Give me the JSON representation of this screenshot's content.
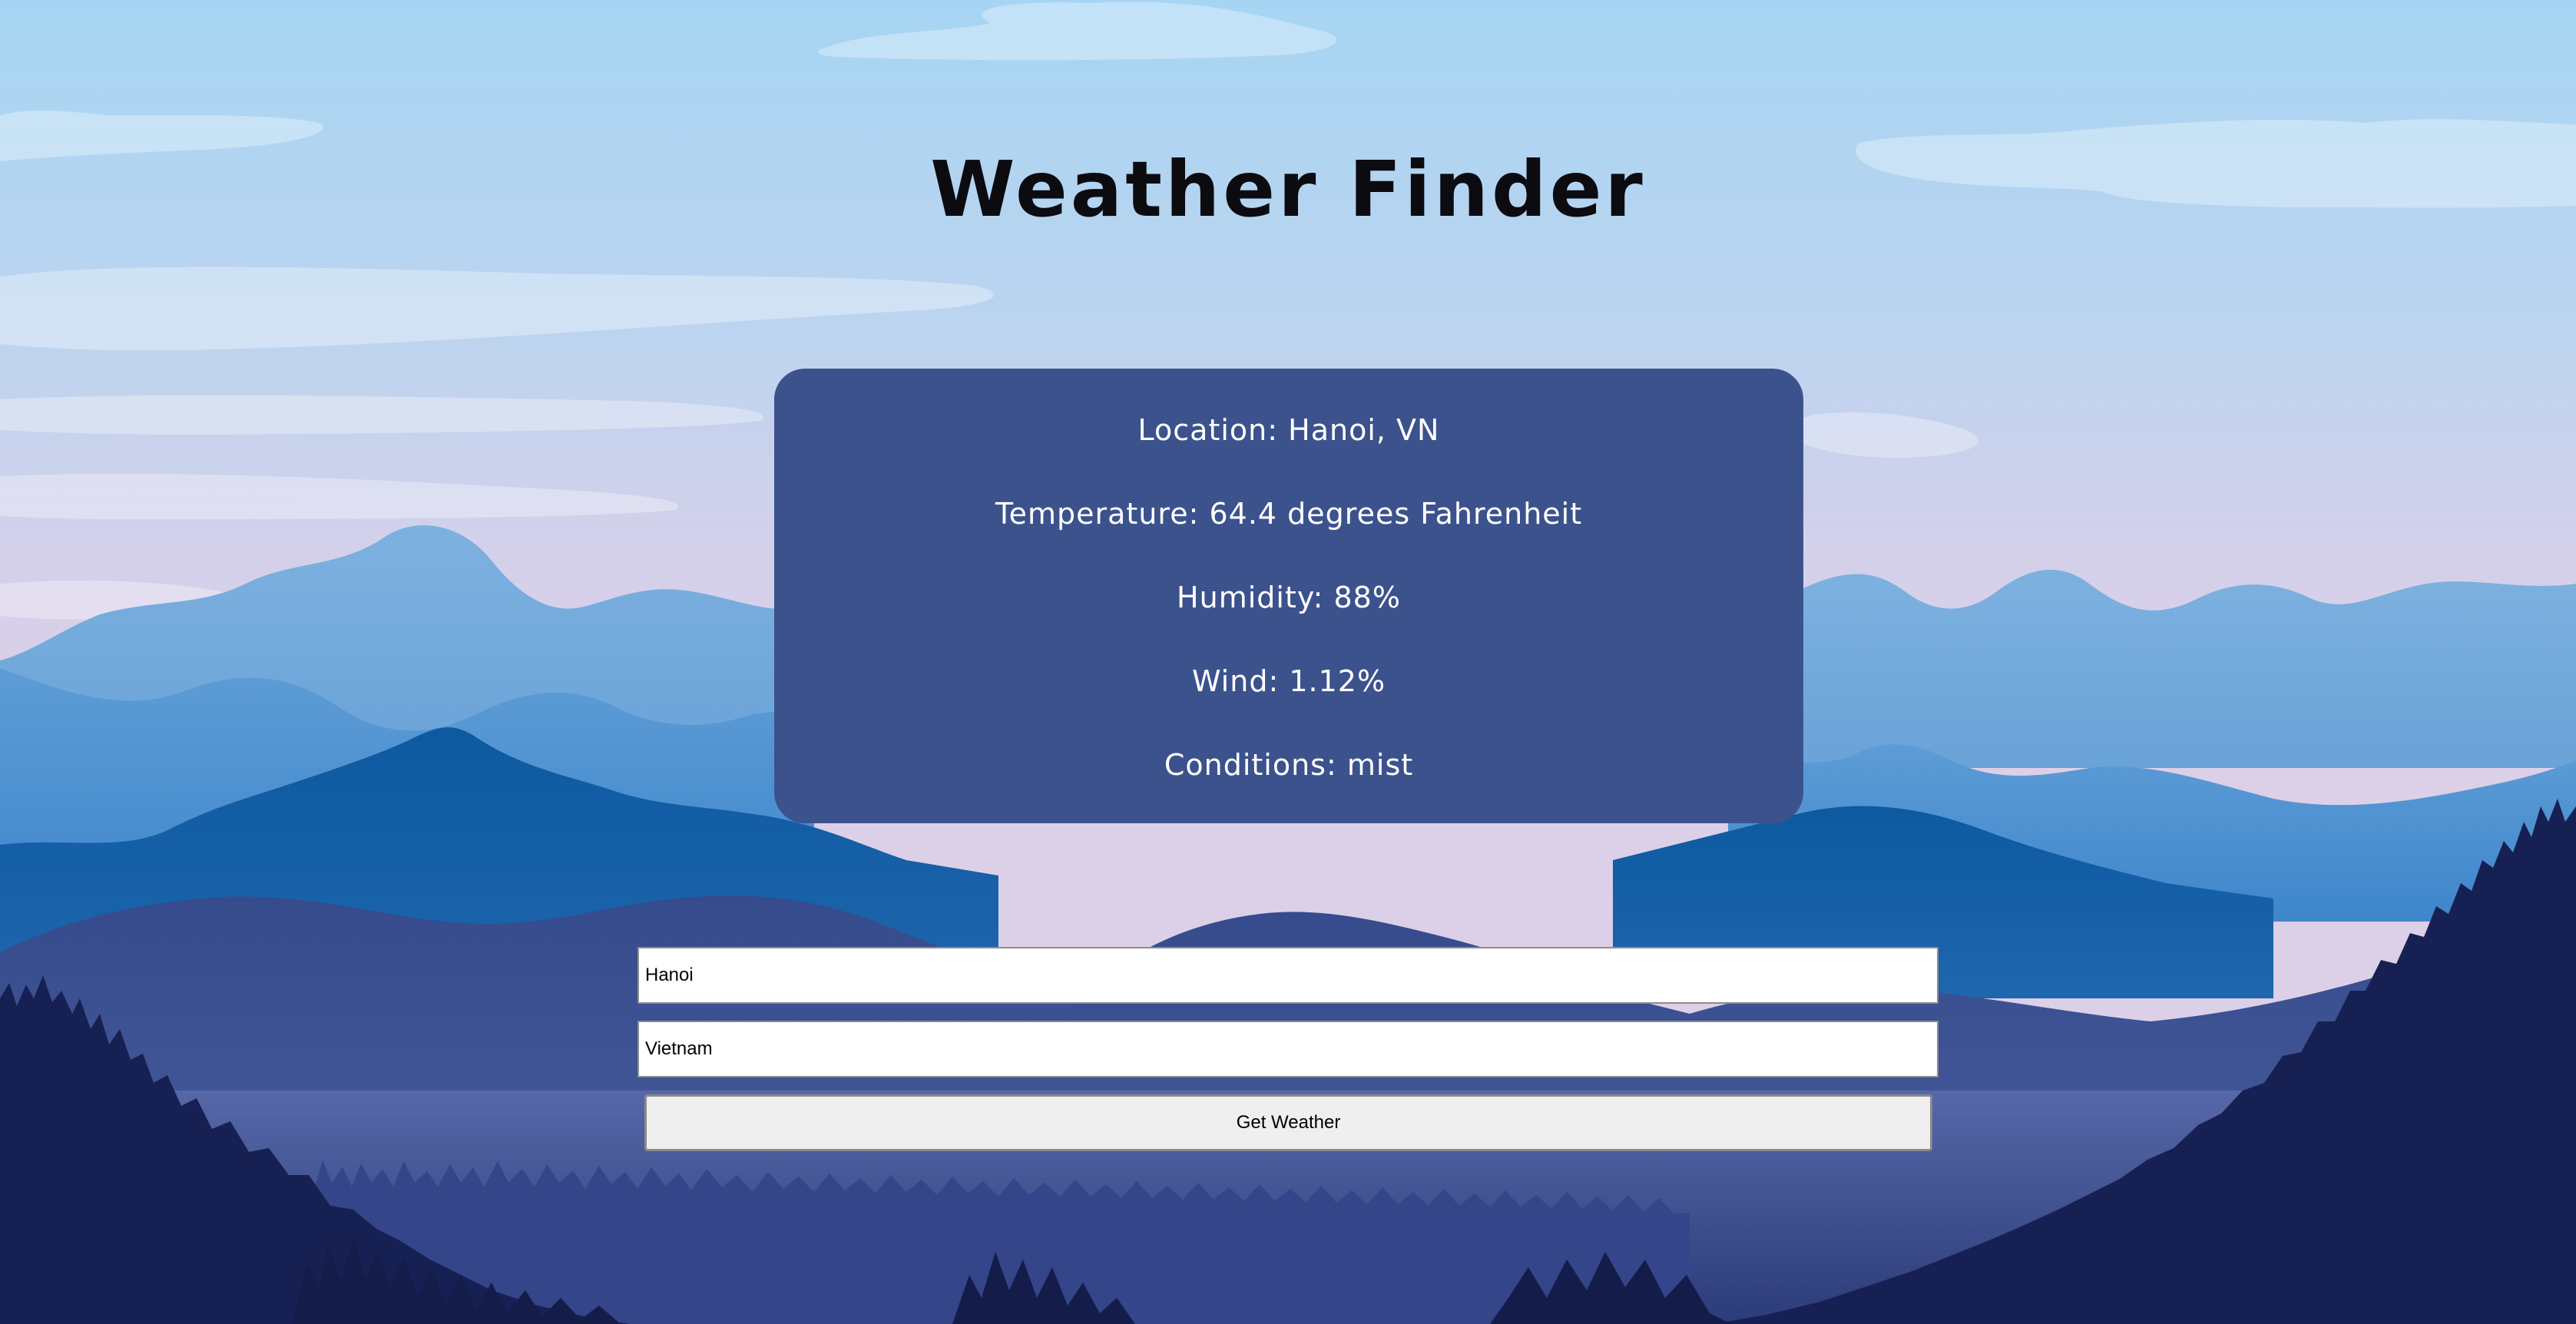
{
  "page": {
    "title": "Weather Finder"
  },
  "weather": {
    "location_label": "Location:",
    "location_value": "Hanoi, VN",
    "temperature_label": "Temperature:",
    "temperature_value": "64.4 degrees Fahrenheit",
    "humidity_label": "Humidity:",
    "humidity_value": "88%",
    "wind_label": "Wind:",
    "wind_value": "1.12%",
    "conditions_label": "Conditions:",
    "conditions_value": "mist"
  },
  "form": {
    "city_value": "Hanoi",
    "country_value": "Vietnam",
    "submit_label": "Get Weather"
  },
  "colors": {
    "card_background": "#3c528d",
    "sky_top": "#a9d6f3",
    "sky_horizon": "#d7d0ea",
    "forest_dark": "#172052"
  }
}
